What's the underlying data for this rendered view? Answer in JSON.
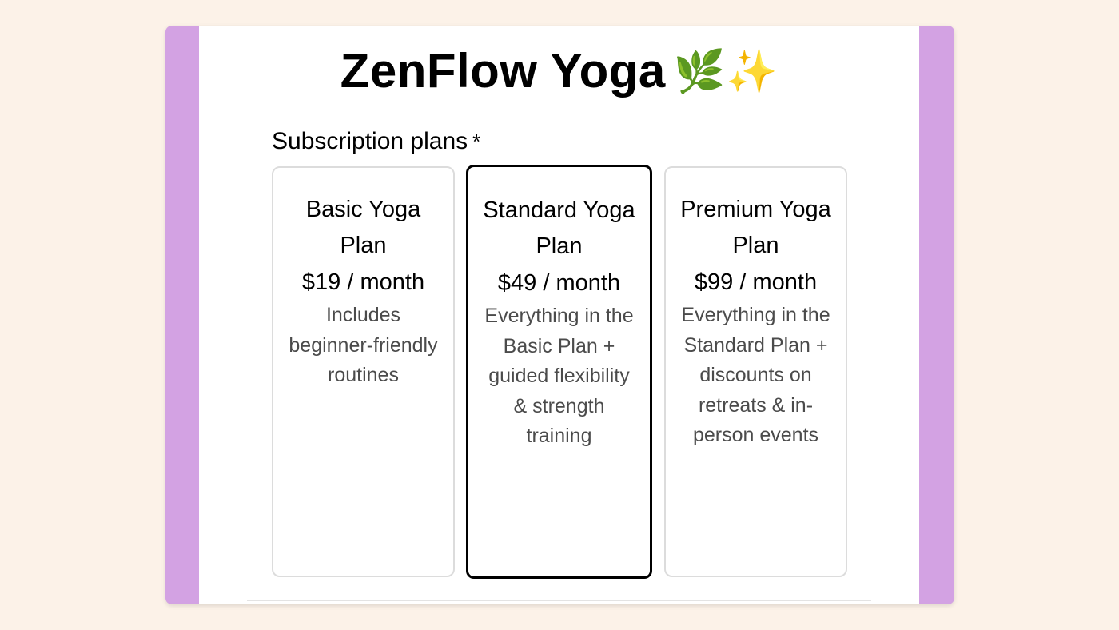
{
  "app": {
    "title": "ZenFlow Yoga",
    "title_emoji": "🌿✨"
  },
  "form": {
    "field_label": "Subscription plans",
    "required_marker": "*",
    "selected_plan": "Standard Yoga Plan"
  },
  "plans": [
    {
      "name": "Basic Yoga Plan",
      "price": "$19 / month",
      "description": "Includes beginner-friendly routines"
    },
    {
      "name": "Standard Yoga Plan",
      "price": "$49 / month",
      "description": "Everything in the Basic Plan + guided flexibility & strength training"
    },
    {
      "name": "Premium Yoga Plan",
      "price": "$99 / month",
      "description": "Everything in the Standard Plan + discounts on retreats & in-person events"
    }
  ],
  "colors": {
    "page_background": "#fcf2e8",
    "frame_accent": "#d3a2e3",
    "selected_border": "#000000",
    "card_border": "#dcdcdc",
    "description_text": "#4b4b4b"
  }
}
